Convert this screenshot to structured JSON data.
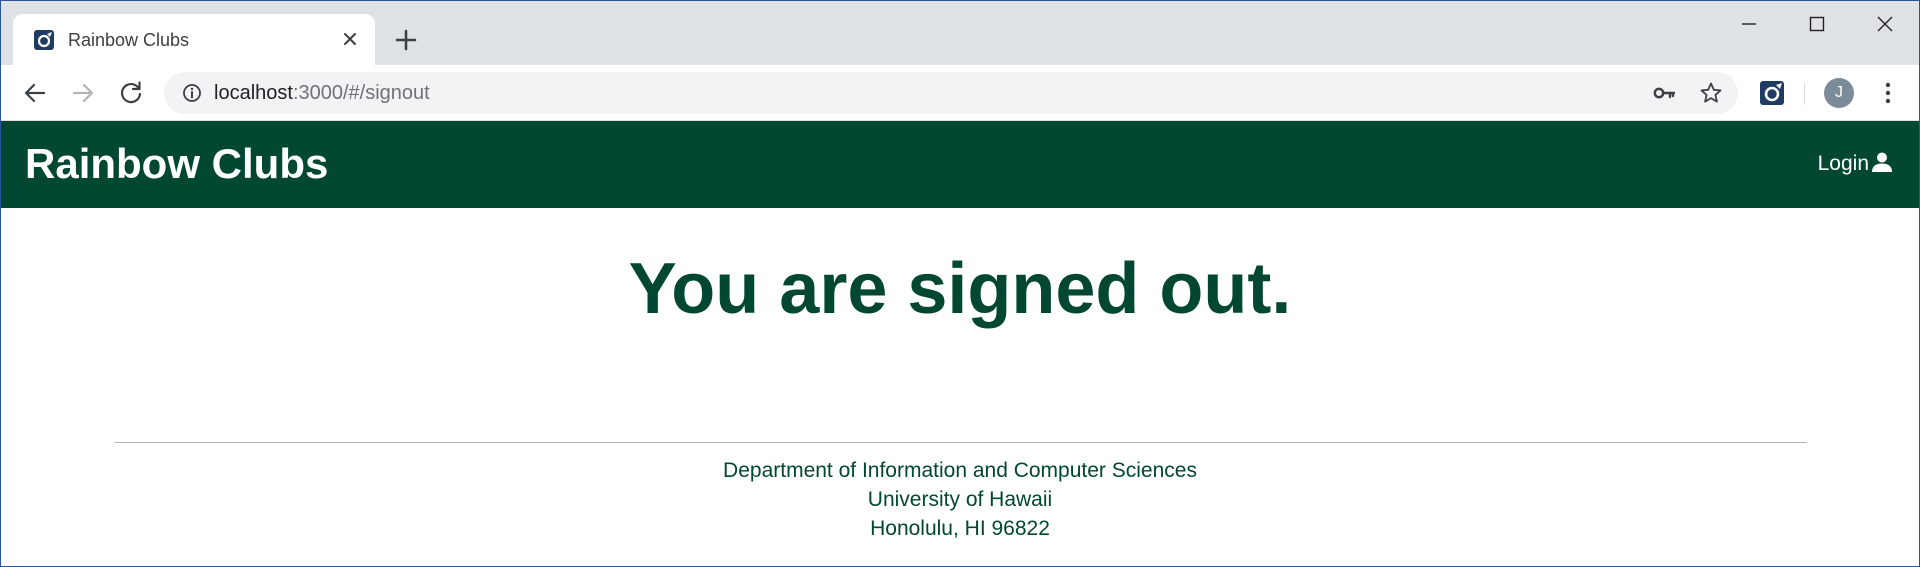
{
  "browser": {
    "tab": {
      "title": "Rainbow Clubs",
      "favicon": "extension-favicon-icon",
      "close_icon": "close-icon"
    },
    "new_tab_icon": "plus-icon",
    "window_controls": [
      "minimize-icon",
      "maximize-icon",
      "close-icon"
    ],
    "nav": [
      "back-arrow-icon",
      "forward-arrow-icon",
      "reload-icon"
    ],
    "address": {
      "host": "localhost",
      "path": ":3000/#/signout",
      "security_icon": "info-icon"
    },
    "omnibox_icons": [
      "key-icon",
      "star-icon"
    ],
    "extension_icon": "extension-icon",
    "profile_initial": "J",
    "menu_icon": "kebab-menu-icon"
  },
  "app": {
    "brand": "Rainbow Clubs",
    "login_label": "Login",
    "login_icon": "user-icon",
    "headline": "You are signed out.",
    "footer": {
      "line1": "Department of Information and Computer Sciences",
      "line2": "University of Hawaii",
      "line3": "Honolulu, HI 96822"
    }
  },
  "colors": {
    "brand_green": "#024731",
    "tabstrip": "#dee1e6",
    "omnibox": "#f1f3f4",
    "avatar": "#7b8b99"
  }
}
